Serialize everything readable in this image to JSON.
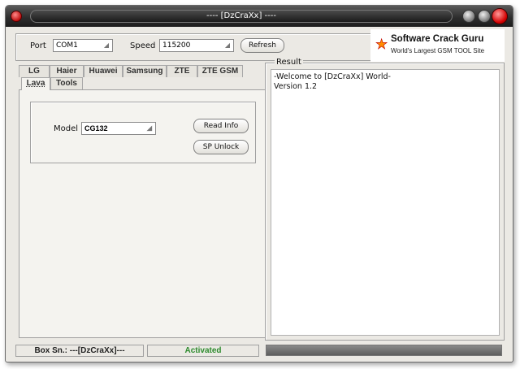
{
  "window": {
    "title": "---- [DzCraXx] ----"
  },
  "top": {
    "port_label": "Port",
    "port_value": "COM1",
    "speed_label": "Speed",
    "speed_value": "115200",
    "refresh_label": "Refresh"
  },
  "logo": {
    "title": "Software Crack Guru",
    "subtitle": "World's Largest GSM TOOL Site"
  },
  "tabs": [
    {
      "label": "LG"
    },
    {
      "label": "Haier"
    },
    {
      "label": "Huawei"
    },
    {
      "label": "Samsung"
    },
    {
      "label": "ZTE"
    },
    {
      "label": "ZTE GSM"
    },
    {
      "label": "Lava"
    },
    {
      "label": "Tools"
    }
  ],
  "active_tab": "Lava",
  "lava": {
    "model_label": "Model",
    "model_value": "CG132",
    "read_info_label": "Read Info",
    "sp_unlock_label": "SP Unlock"
  },
  "result": {
    "label": "Result",
    "lines": [
      "-Welcome to [DzCraXx] World-",
      "Version 1.2"
    ]
  },
  "status": {
    "box_sn": "Box Sn.: ---[DzCraXx]---",
    "activation": "Activated",
    "activation_color": "#2e8b2e",
    "progress": 0
  }
}
